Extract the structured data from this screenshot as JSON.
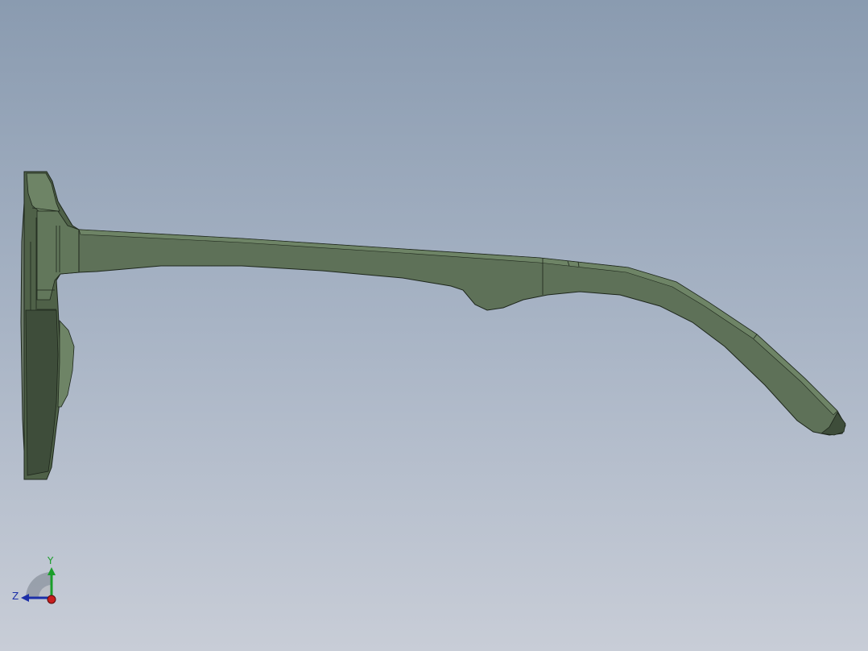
{
  "viewport": {
    "background_top": "#8a9bb0",
    "background_bottom": "#c8cdd7"
  },
  "model": {
    "name": "sunglasses-side-view",
    "body_color": "#5e7158",
    "light_color": "#6e8466",
    "dark_color": "#3e4d3a",
    "edge_color": "#1d261b"
  },
  "triad": {
    "y_label": "Y",
    "z_label": "Z",
    "y_color": "#1a9e2a",
    "z_color": "#1c2fa8",
    "x_color": "#c81e1e"
  }
}
